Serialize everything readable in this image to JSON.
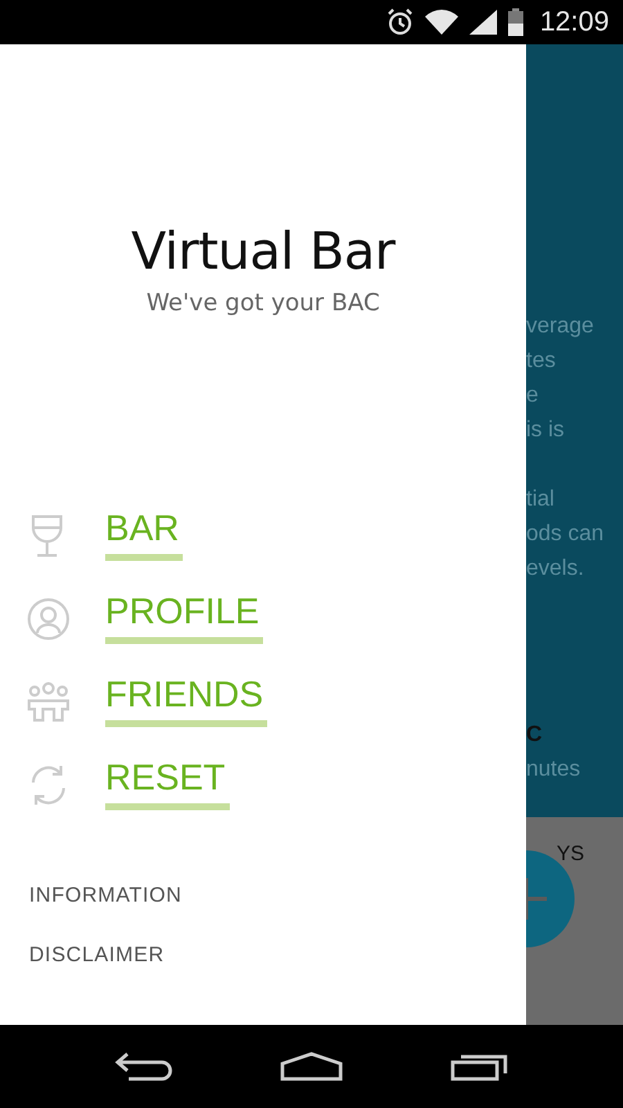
{
  "status_bar": {
    "time": "12:09"
  },
  "drawer": {
    "title": "Virtual Bar",
    "subtitle": "We've got your BAC",
    "menu": [
      {
        "label": "BAR"
      },
      {
        "label": "PROFILE"
      },
      {
        "label": "FRIENDS"
      },
      {
        "label": "RESET"
      }
    ],
    "links": [
      "INFORMATION",
      "DISCLAIMER"
    ]
  },
  "background": {
    "paragraphs": [
      [
        "verage",
        "tes",
        "e",
        "is is"
      ],
      [
        "tial",
        "ods can",
        "evels."
      ]
    ],
    "stat": {
      "heading": "C",
      "text": "nutes"
    },
    "lower_label": "YS"
  }
}
